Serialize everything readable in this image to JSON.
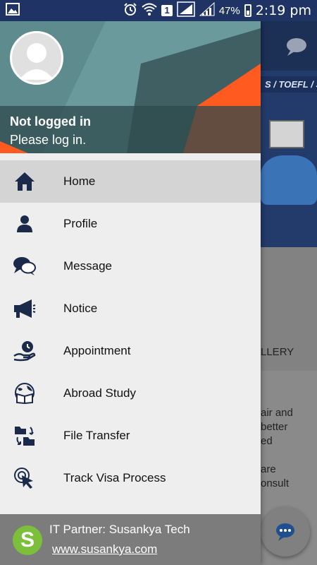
{
  "status_bar": {
    "sim_slot": "1",
    "battery": "47%",
    "time": "2:19 pm",
    "icons": [
      "gallery-icon",
      "alarm-icon",
      "wifi-icon",
      "signal-icon",
      "signal-icon-2",
      "battery-icon"
    ]
  },
  "drawer": {
    "user_name": "Not logged in",
    "user_sub": "Please log in.",
    "menu": [
      {
        "label": "Home",
        "icon": "home-icon",
        "active": true
      },
      {
        "label": "Profile",
        "icon": "person-icon"
      },
      {
        "label": "Message",
        "icon": "chat-icon"
      },
      {
        "label": "Notice",
        "icon": "megaphone-icon"
      },
      {
        "label": "Appointment",
        "icon": "appointment-icon"
      },
      {
        "label": "Abroad Study",
        "icon": "globe-book-icon"
      },
      {
        "label": "File Transfer",
        "icon": "folder-transfer-icon"
      },
      {
        "label": "Track Visa Process",
        "icon": "cursor-click-icon"
      }
    ],
    "footer": {
      "partner": "IT Partner: Susankya Tech",
      "site": "www.susankya.com",
      "logo_letter": "S"
    }
  },
  "background": {
    "banner_tests": "S / TOEFL / SAT",
    "gallery": "LLERY",
    "text_lines": [
      "air and",
      "better",
      "ed",
      "",
      "are",
      "onsult"
    ]
  },
  "colors": {
    "status_bar": "#1f3464",
    "accent_orange": "#ff5a1f",
    "icon_navy": "#1b2a4a",
    "active_row": "#d4d4d4"
  }
}
